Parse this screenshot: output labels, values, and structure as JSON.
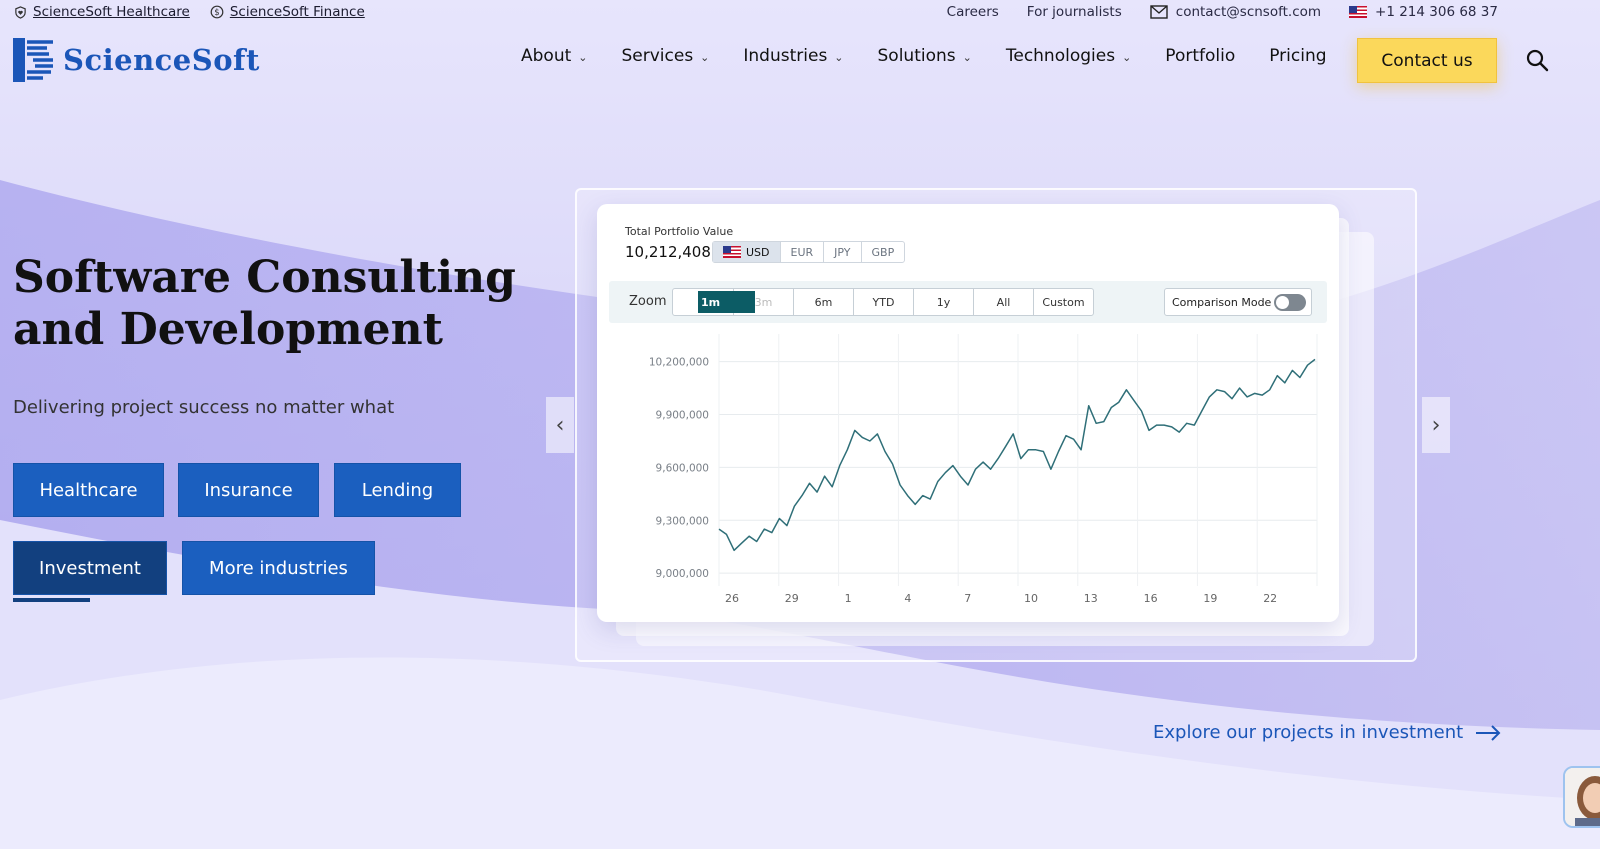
{
  "topbar": {
    "links": [
      "ScienceSoft Healthcare",
      "ScienceSoft Finance"
    ],
    "careers": "Careers",
    "journalists": "For journalists",
    "email": "contact@scnsoft.com",
    "phone": "+1 214 306 68 37"
  },
  "logo": {
    "text": "ScienceSoft"
  },
  "nav": {
    "items": [
      "About",
      "Services",
      "Industries",
      "Solutions",
      "Technologies",
      "Portfolio",
      "Pricing"
    ],
    "contact": "Contact us"
  },
  "hero": {
    "title_line1": "Software Consulting",
    "title_line2": "and Development",
    "subtitle": "Delivering project success no matter what",
    "buttons": [
      "Healthcare",
      "Insurance",
      "Lending",
      "Investment",
      "More industries"
    ],
    "active_button": "Investment"
  },
  "widget": {
    "label": "Total Portfolio Value",
    "value": "10,212,408",
    "currencies": [
      "USD",
      "EUR",
      "JPY",
      "GBP"
    ],
    "selected_currency": "USD",
    "zoom_label": "Zoom",
    "zoom_options": [
      "1m",
      "3m",
      "6m",
      "YTD",
      "1y",
      "All",
      "Custom"
    ],
    "selected_zoom": "1m",
    "comparison": "Comparison Mode",
    "comparison_on": false
  },
  "chart_data": {
    "type": "line",
    "ylim": [
      8950000,
      10300000
    ],
    "yticks": [
      "10,200,000",
      "9,900,000",
      "9,600,000",
      "9,300,000",
      "9,000,000"
    ],
    "ytick_values": [
      10200000,
      9900000,
      9600000,
      9300000,
      9000000
    ],
    "xticks": [
      "26",
      "29",
      "1",
      "4",
      "7",
      "10",
      "13",
      "16",
      "19",
      "22"
    ],
    "grid": true,
    "series": [
      {
        "values": [
          9250000,
          9220000,
          9130000,
          9170000,
          9210000,
          9180000,
          9250000,
          9230000,
          9310000,
          9270000,
          9380000,
          9440000,
          9510000,
          9460000,
          9550000,
          9490000,
          9610000,
          9700000,
          9810000,
          9770000,
          9750000,
          9790000,
          9690000,
          9620000,
          9500000,
          9440000,
          9390000,
          9440000,
          9420000,
          9520000,
          9570000,
          9610000,
          9550000,
          9500000,
          9590000,
          9630000,
          9590000,
          9650000,
          9720000,
          9790000,
          9650000,
          9700000,
          9700000,
          9690000,
          9590000,
          9690000,
          9780000,
          9760000,
          9700000,
          9950000,
          9850000,
          9860000,
          9940000,
          9970000,
          10040000,
          9980000,
          9920000,
          9810000,
          9840000,
          9840000,
          9830000,
          9800000,
          9850000,
          9840000,
          9920000,
          10000000,
          10040000,
          10030000,
          9990000,
          10050000,
          10000000,
          10020000,
          10010000,
          10040000,
          10120000,
          10080000,
          10150000,
          10110000,
          10180000,
          10212408
        ]
      }
    ]
  },
  "explore": "Explore our projects in investment",
  "colors": {
    "brand": "#1b5fbf",
    "brand_dark": "#12407f",
    "accent": "#fbd85b",
    "chart_line": "#2f6f78"
  }
}
